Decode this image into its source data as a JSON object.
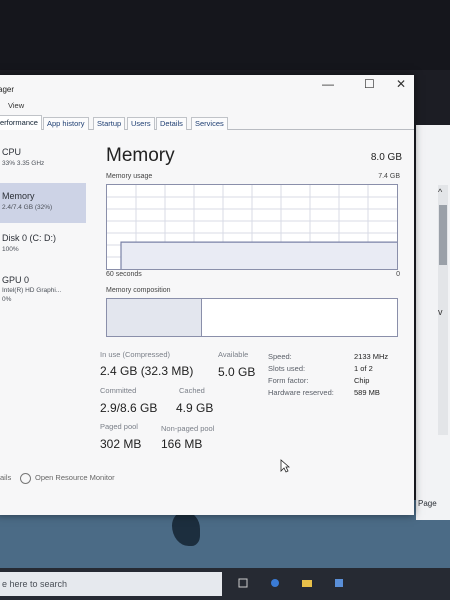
{
  "window": {
    "title": "ager",
    "controls": {
      "minimize": "—",
      "maximize": "☐",
      "close": "✕"
    }
  },
  "menu": {
    "item_view": "View"
  },
  "tabs": [
    {
      "label": "erformance",
      "active": true
    },
    {
      "label": "App history"
    },
    {
      "label": "Startup"
    },
    {
      "label": "Users"
    },
    {
      "label": "Details"
    },
    {
      "label": "Services"
    }
  ],
  "sidebar": [
    {
      "name": "CPU",
      "sub": "33% 3.35 GHz"
    },
    {
      "name": "Memory",
      "sub": "2.4/7.4 GB (32%)",
      "selected": true
    },
    {
      "name": "Disk 0 (C: D:)",
      "sub": "100%"
    },
    {
      "name": "GPU 0",
      "sub": "Intel(R) HD Graphi...",
      "sub2": "0%"
    }
  ],
  "memory": {
    "title": "Memory",
    "total": "8.0 GB",
    "usage_label": "Memory usage",
    "usage_max": "7.4 GB",
    "time_left": "60 seconds",
    "time_right": "0",
    "composition_label": "Memory composition",
    "usage_fraction": 0.32
  },
  "stats": {
    "in_use_label": "In use (Compressed)",
    "in_use_value": "2.4 GB (32.3 MB)",
    "available_label": "Available",
    "available_value": "5.0 GB",
    "committed_label": "Committed",
    "committed_value": "2.9/8.6 GB",
    "cached_label": "Cached",
    "cached_value": "4.9 GB",
    "paged_label": "Paged pool",
    "paged_value": "302 MB",
    "nonpaged_label": "Non-paged pool",
    "nonpaged_value": "166 MB"
  },
  "specs": [
    {
      "label": "Speed:",
      "value": "2133 MHz"
    },
    {
      "label": "Slots used:",
      "value": "1 of 2"
    },
    {
      "label": "Form factor:",
      "value": "Chip"
    },
    {
      "label": "Hardware reserved:",
      "value": "589 MB"
    }
  ],
  "footer": {
    "fewer_details": "ails",
    "open_monitor": "Open Resource Monitor"
  },
  "taskbar": {
    "search_placeholder": "e here to search"
  },
  "side_app": {
    "page_label": "Page"
  },
  "colors": {
    "graph_line": "#7a81a6",
    "graph_fill": "#e9ebf4",
    "selected_bg": "#cdd3e6"
  }
}
